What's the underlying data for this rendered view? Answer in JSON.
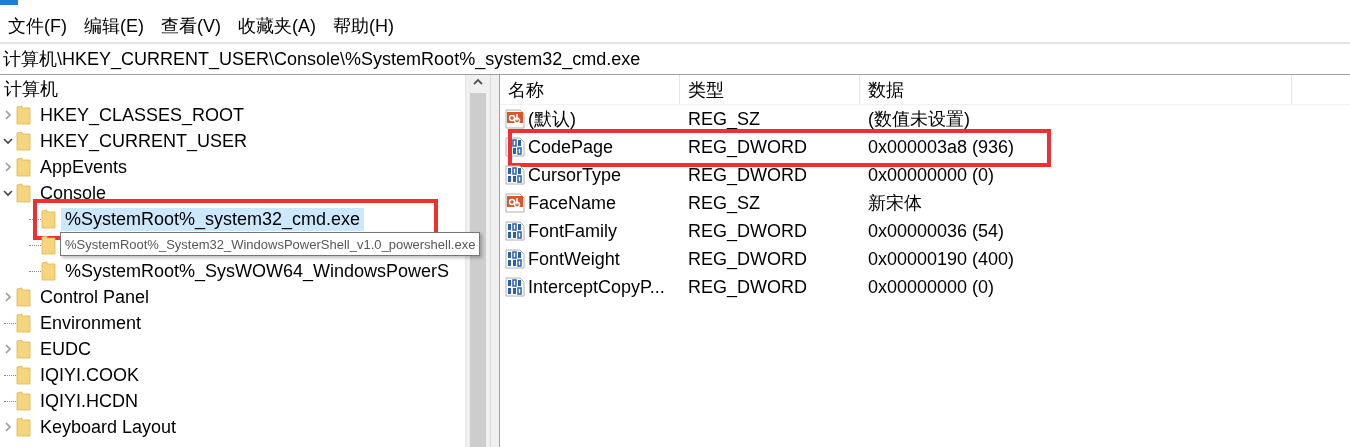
{
  "menu": [
    "文件(F)",
    "编辑(E)",
    "查看(V)",
    "收藏夹(A)",
    "帮助(H)"
  ],
  "address": "计算机\\HKEY_CURRENT_USER\\Console\\%SystemRoot%_system32_cmd.exe",
  "tree": {
    "label": "计算机",
    "children": [
      {
        "label": "HKEY_CLASSES_ROOT",
        "expandable": true,
        "expanded": false,
        "selected": false,
        "highlighted": false
      },
      {
        "label": "HKEY_CURRENT_USER",
        "expandable": true,
        "expanded": true,
        "selected": false,
        "highlighted": false,
        "children": [
          {
            "label": "AppEvents",
            "expandable": true,
            "expanded": false,
            "selected": false,
            "highlighted": false
          },
          {
            "label": "Console",
            "expandable": true,
            "expanded": true,
            "selected": false,
            "highlighted": false,
            "children": [
              {
                "label": "%SystemRoot%_system32_cmd.exe",
                "expandable": false,
                "expanded": false,
                "selected": true,
                "highlighted": true
              },
              {
                "expandable": false,
                "expanded": false,
                "selected": false,
                "highlighted": false
              },
              {
                "label": "%SystemRoot%_SysWOW64_WindowsPowerS",
                "expandable": false,
                "expanded": false,
                "selected": false,
                "highlighted": false
              }
            ]
          },
          {
            "label": "Control Panel",
            "expandable": true,
            "expanded": false,
            "selected": false,
            "highlighted": false
          },
          {
            "label": "Environment",
            "expandable": false,
            "expanded": false,
            "selected": false,
            "highlighted": false
          },
          {
            "label": "EUDC",
            "expandable": true,
            "expanded": false,
            "selected": false,
            "highlighted": false
          },
          {
            "label": "IQIYI.COOK",
            "expandable": false,
            "expanded": false,
            "selected": false,
            "highlighted": false
          },
          {
            "label": "IQIYI.HCDN",
            "expandable": false,
            "expanded": false,
            "selected": false,
            "highlighted": false
          },
          {
            "label": "Keyboard Layout",
            "expandable": true,
            "expanded": false,
            "selected": false,
            "highlighted": false
          }
        ]
      }
    ]
  },
  "tooltip": "%SystemRoot%_System32_WindowsPowerShell_v1.0_powershell.exe",
  "columns": [
    "名称",
    "类型",
    "数据"
  ],
  "values": [
    {
      "kind": "string",
      "name": "(默认)",
      "type": "REG_SZ",
      "data": "(数值未设置)",
      "highlighted": false
    },
    {
      "kind": "binary",
      "name": "CodePage",
      "type": "REG_DWORD",
      "data": "0x000003a8 (936)",
      "highlighted": true
    },
    {
      "kind": "binary",
      "name": "CursorType",
      "type": "REG_DWORD",
      "data": "0x00000000 (0)",
      "highlighted": false
    },
    {
      "kind": "string",
      "name": "FaceName",
      "type": "REG_SZ",
      "data": "新宋体",
      "highlighted": false
    },
    {
      "kind": "binary",
      "name": "FontFamily",
      "type": "REG_DWORD",
      "data": "0x00000036 (54)",
      "highlighted": false
    },
    {
      "kind": "binary",
      "name": "FontWeight",
      "type": "REG_DWORD",
      "data": "0x00000190 (400)",
      "highlighted": false
    },
    {
      "kind": "binary",
      "name": "InterceptCopyP...",
      "type": "REG_DWORD",
      "data": "0x00000000 (0)",
      "highlighted": false
    }
  ]
}
